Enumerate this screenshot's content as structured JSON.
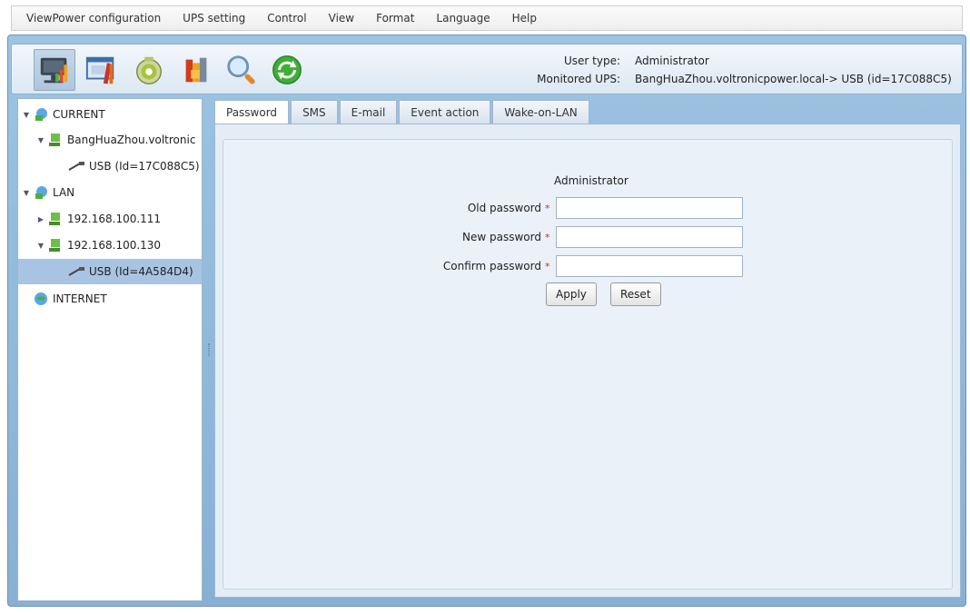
{
  "menu": [
    "ViewPower configuration",
    "UPS setting",
    "Control",
    "View",
    "Format",
    "Language",
    "Help"
  ],
  "toolbar": {
    "icons": [
      "monitor-icon",
      "configuration-icon",
      "ups-icon",
      "data-log-icon",
      "search-icon",
      "refresh-icon"
    ]
  },
  "userinfo": {
    "user_type_label": "User type:",
    "user_type_value": "Administrator",
    "monitored_label": "Monitored UPS:",
    "monitored_value": "BangHuaZhou.voltronicpower.local-> USB (id=17C088C5)"
  },
  "tree": {
    "current": "CURRENT",
    "current_host": "BangHuaZhou.voltronic",
    "current_usb": "USB (Id=17C088C5)",
    "lan": "LAN",
    "lan_host1": "192.168.100.111",
    "lan_host2": "192.168.100.130",
    "lan_usb": "USB (Id=4A584D4)",
    "internet": "INTERNET"
  },
  "tabs": [
    "Password",
    "SMS",
    "E-mail",
    "Event action",
    "Wake-on-LAN"
  ],
  "form": {
    "title": "Administrator",
    "old_password": "Old password",
    "new_password": "New password",
    "confirm_password": "Confirm password",
    "required_mark": "*",
    "apply": "Apply",
    "reset": "Reset"
  }
}
